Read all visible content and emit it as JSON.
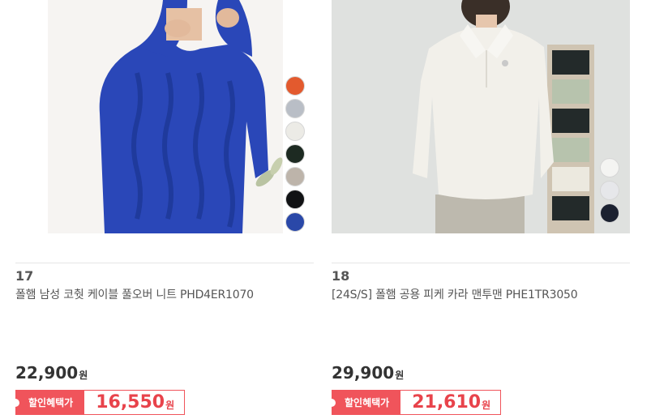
{
  "products": [
    {
      "rank": "17",
      "title": "폴햄 남성 코췃 케이블 풀오버 니트 PHD4ER1070",
      "price": "22,900",
      "currency": "원",
      "discount_label": "할인혜택가",
      "discount_price": "16,550",
      "swatch_colors": [
        "#e35a2e",
        "#b9bec6",
        "#ecebe6",
        "#1d2a22",
        "#bdb4aa",
        "#111214",
        "#2a48a8"
      ]
    },
    {
      "rank": "18",
      "title": "[24S/S] 폴햄 공용 피케 카라 맨투맨 PHE1TR3050",
      "price": "29,900",
      "currency": "원",
      "discount_label": "할인혜택가",
      "discount_price": "21,610",
      "swatch_colors": [
        "#f4f4f2",
        "#e6e7ea",
        "#1b2130"
      ]
    }
  ]
}
